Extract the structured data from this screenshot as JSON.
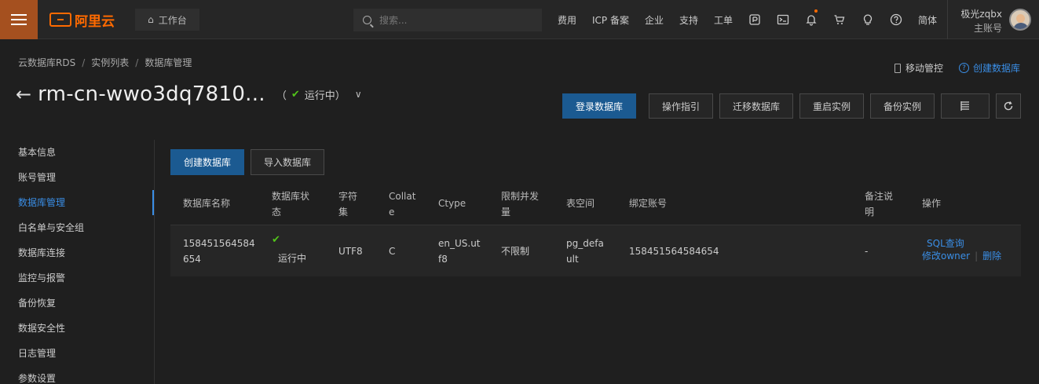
{
  "topbar": {
    "logo_text": "阿里云",
    "workbench_label": "工作台",
    "search_placeholder": "搜索...",
    "nav_items": [
      "费用",
      "ICP 备案",
      "企业",
      "支持",
      "工单"
    ],
    "lang_label": "简体",
    "user_name": "极光zqbx",
    "user_type": "主账号"
  },
  "breadcrumb": [
    "云数据库RDS",
    "实例列表",
    "数据库管理"
  ],
  "header": {
    "instance_name": "rm-cn-wwo3dq7810...",
    "status_open": "（",
    "status_text": "运行中",
    "status_close": "）",
    "mobile_label": "移动管控",
    "create_db_link": "创建数据库"
  },
  "actions": {
    "login_db": "登录数据库",
    "guide": "操作指引",
    "migrate": "迁移数据库",
    "restart": "重启实例",
    "backup": "备份实例"
  },
  "sidebar": {
    "items": [
      {
        "label": "基本信息",
        "active": false
      },
      {
        "label": "账号管理",
        "active": false
      },
      {
        "label": "数据库管理",
        "active": true
      },
      {
        "label": "白名单与安全组",
        "active": false
      },
      {
        "label": "数据库连接",
        "active": false
      },
      {
        "label": "监控与报警",
        "active": false
      },
      {
        "label": "备份恢复",
        "active": false
      },
      {
        "label": "数据安全性",
        "active": false
      },
      {
        "label": "日志管理",
        "active": false
      },
      {
        "label": "参数设置",
        "active": false
      }
    ]
  },
  "toolbar": {
    "create_db": "创建数据库",
    "import_db": "导入数据库"
  },
  "table": {
    "headers": {
      "name": "数据库名称",
      "status_l1": "数据库状",
      "status_l2": "态",
      "charset_l1": "字符",
      "charset_l2": "集",
      "collate_l1": "Collat",
      "collate_l2": "e",
      "ctype": "Ctype",
      "limit_l1": "限制并发",
      "limit_l2": "量",
      "tablespace": "表空间",
      "account": "绑定账号",
      "remark_l1": "备注说",
      "remark_l2": "明",
      "ops": "操作"
    },
    "rows": [
      {
        "name_l1": "158451564584",
        "name_l2": "654",
        "status": "运行中",
        "charset": "UTF8",
        "collate": "C",
        "ctype_l1": "en_US.ut",
        "ctype_l2": "f8",
        "limit": "不限制",
        "tablespace_l1": "pg_defa",
        "tablespace_l2": "ult",
        "account": "158451564584654",
        "remark": "-",
        "op_sql": "SQL查询",
        "op_owner": "修改owner",
        "op_sep": "|",
        "op_delete": "删除"
      }
    ]
  }
}
